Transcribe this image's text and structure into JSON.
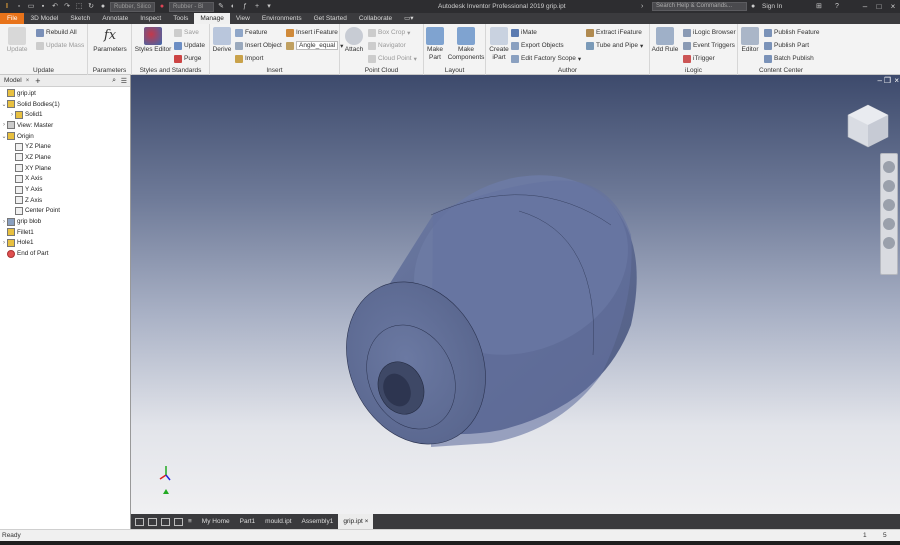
{
  "titlebar": {
    "app_title": "Autodesk Inventor Professional 2019    grip.ipt",
    "material": "Rubber, Silico",
    "appearance": "Rubber - Bl",
    "search_placeholder": "Search Help & Commands...",
    "signin": "Sign In"
  },
  "tabs": [
    "File",
    "3D Model",
    "Sketch",
    "Annotate",
    "Inspect",
    "Tools",
    "Manage",
    "View",
    "Environments",
    "Get Started",
    "Collaborate"
  ],
  "ribbon": {
    "update": {
      "update": "Update",
      "rebuild_all": "Rebuild All",
      "update_mass": "Update Mass",
      "title": "Update"
    },
    "parameters": {
      "parameters": "Parameters",
      "title": "Parameters"
    },
    "styles": {
      "styles_editor": "Styles Editor",
      "save": "Save",
      "update": "Update",
      "purge": "Purge",
      "title": "Styles and Standards"
    },
    "insert": {
      "derive": "Derive",
      "feature": "Feature",
      "insert_object": "Insert Object",
      "import": "Import",
      "insert_ifeature": "Insert iFeature",
      "angle_combo": "Angle_equal",
      "title": "Insert"
    },
    "pointcloud": {
      "attach": "Attach",
      "box_crop": "Box Crop",
      "navigator": "Navigator",
      "cloud_point": "Cloud Point",
      "title": "Point Cloud"
    },
    "layout": {
      "make_part": "Make Part",
      "make_components": "Make Components",
      "title": "Layout"
    },
    "author": {
      "create_ipart": "Create iPart",
      "imate": "iMate",
      "export_objects": "Export Objects",
      "edit_factory_scope": "Edit Factory Scope",
      "extract_ifeature": "Extract iFeature",
      "tube_and_pipe": "Tube and Pipe",
      "title": "Author"
    },
    "ilogic": {
      "add_rule": "Add Rule",
      "ilogic_browser": "iLogic Browser",
      "event_triggers": "Event Triggers",
      "itrigger": "iTrigger",
      "title": "iLogic"
    },
    "content": {
      "editor": "Editor",
      "publish_feature": "Publish Feature",
      "publish_part": "Publish Part",
      "batch_publish": "Batch Publish",
      "title": "Content Center"
    }
  },
  "browser": {
    "title": "Model",
    "tree": [
      {
        "label": "grip.ipt",
        "level": 0,
        "exp": "",
        "icon": "part-icon"
      },
      {
        "label": "Solid Bodies(1)",
        "level": 0,
        "exp": "⌄",
        "icon": "solid-bodies-folder-icon"
      },
      {
        "label": "Solid1",
        "level": 1,
        "exp": "›",
        "icon": "solid-body-icon"
      },
      {
        "label": "View: Master",
        "level": 0,
        "exp": "›",
        "icon": "view-icon"
      },
      {
        "label": "Origin",
        "level": 0,
        "exp": "⌄",
        "icon": "origin-folder-icon"
      },
      {
        "label": "YZ Plane",
        "level": 1,
        "exp": "",
        "icon": "plane-icon"
      },
      {
        "label": "XZ Plane",
        "level": 1,
        "exp": "",
        "icon": "plane-icon"
      },
      {
        "label": "XY Plane",
        "level": 1,
        "exp": "",
        "icon": "plane-icon"
      },
      {
        "label": "X Axis",
        "level": 1,
        "exp": "",
        "icon": "axis-icon"
      },
      {
        "label": "Y Axis",
        "level": 1,
        "exp": "",
        "icon": "axis-icon"
      },
      {
        "label": "Z Axis",
        "level": 1,
        "exp": "",
        "icon": "axis-icon"
      },
      {
        "label": "Center Point",
        "level": 1,
        "exp": "",
        "icon": "center-point-icon"
      },
      {
        "label": "grip blob",
        "level": 0,
        "exp": "›",
        "icon": "revolve-feature-icon"
      },
      {
        "label": "Fillet1",
        "level": 0,
        "exp": "",
        "icon": "fillet-feature-icon"
      },
      {
        "label": "Hole1",
        "level": 0,
        "exp": "›",
        "icon": "hole-feature-icon"
      },
      {
        "label": "End of Part",
        "level": 0,
        "exp": "",
        "icon": "end-of-part-icon"
      }
    ]
  },
  "doc_tabs": [
    "My Home",
    "Part1",
    "mould.ipt",
    "Assembly1",
    "grip.ipt"
  ],
  "active_doc": "grip.ipt",
  "status": {
    "text": "Ready",
    "num1": "1",
    "num2": "5"
  },
  "colors": {
    "accent": "#e8731a",
    "part": "#5e6c94"
  }
}
